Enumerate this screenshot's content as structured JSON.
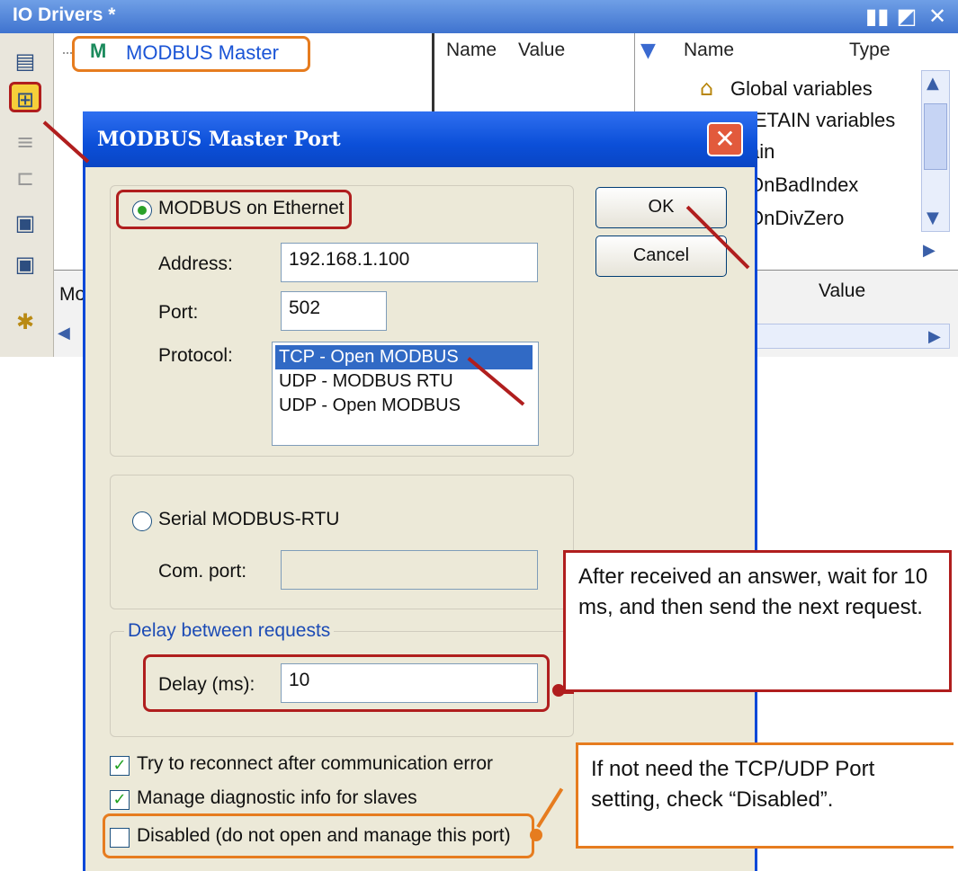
{
  "bg_window": {
    "title": "IO Drivers *",
    "controls": [
      "▮▮",
      "◩",
      "✕"
    ],
    "tree_item_icon_text": "M",
    "tree_item": "MODBUS Master",
    "grid_columns": [
      "Name",
      "Value"
    ],
    "vars_columns": [
      "Name",
      "Type"
    ],
    "vars_rows": [
      "Global variables",
      "RETAIN variables",
      "ain",
      "OnBadIndex",
      "OnDivZero"
    ],
    "lower_left_label": "Mo",
    "lower_value_header": "Value"
  },
  "dialog": {
    "title": "MODBUS Master Port",
    "ok_label": "OK",
    "cancel_label": "Cancel",
    "ethernet_radio_label": "MODBUS on Ethernet",
    "address_label": "Address:",
    "address_value": "192.168.1.100",
    "port_label": "Port:",
    "port_value": "502",
    "protocol_label": "Protocol:",
    "protocol_options": [
      "TCP - Open MODBUS",
      "UDP - MODBUS RTU",
      "UDP - Open MODBUS"
    ],
    "serial_radio_label": "Serial MODBUS-RTU",
    "com_port_label": "Com. port:",
    "com_port_value": "",
    "delay_group_label": "Delay between requests",
    "delay_label": "Delay (ms):",
    "delay_value": "10",
    "reconnect_label": "Try to reconnect after communication error",
    "diagnostic_label": "Manage diagnostic info for slaves",
    "disabled_label": "Disabled (do not open and manage this port)"
  },
  "callouts": {
    "delay_note": "After received an answer, wait for 10 ms, and then send the next request.",
    "disabled_note": "If not need the TCP/UDP Port setting, check “Disabled”."
  },
  "colors": {
    "annotation_red": "#b01e1e",
    "annotation_orange": "#e67c1f",
    "dialog_title_blue": "#0b4fd8"
  }
}
